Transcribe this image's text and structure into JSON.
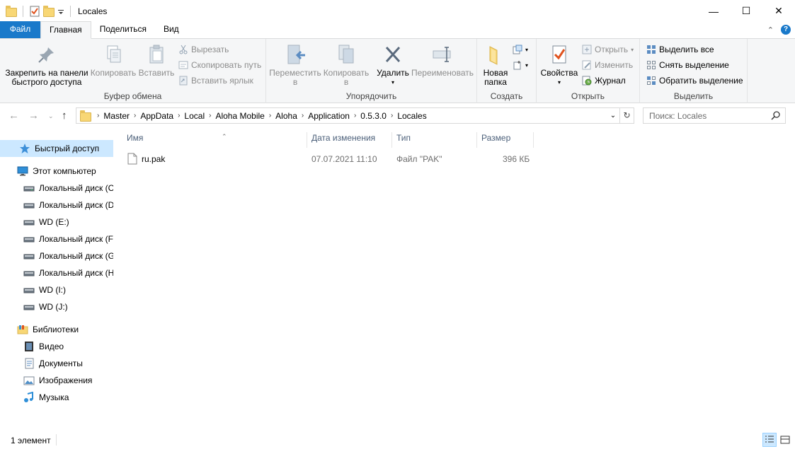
{
  "window": {
    "title": "Locales",
    "minimize": "—",
    "maximize": "☐",
    "close": "✕"
  },
  "tabs": [
    {
      "label": "Файл"
    },
    {
      "label": "Главная"
    },
    {
      "label": "Поделиться"
    },
    {
      "label": "Вид"
    }
  ],
  "ribbon": {
    "clipboard": {
      "label": "Буфер обмена",
      "pin": "Закрепить на панели быстрого доступа",
      "pin_line1": "Закрепить на панели",
      "pin_line2": "быстрого доступа",
      "copy": "Копировать",
      "paste": "Вставить",
      "cut": "Вырезать",
      "copy_path": "Скопировать путь",
      "paste_shortcut": "Вставить ярлык"
    },
    "organize": {
      "label": "Упорядочить",
      "move_line1": "Переместить",
      "move_line2": "в",
      "copy_line1": "Копировать",
      "copy_line2": "в",
      "delete": "Удалить",
      "rename": "Переименовать"
    },
    "new": {
      "label": "Создать",
      "new_folder_line1": "Новая",
      "new_folder_line2": "папка"
    },
    "open": {
      "label": "Открыть",
      "properties": "Свойства",
      "open": "Открыть",
      "edit": "Изменить",
      "history": "Журнал"
    },
    "select": {
      "label": "Выделить",
      "select_all": "Выделить все",
      "select_none": "Снять выделение",
      "invert": "Обратить выделение"
    }
  },
  "address": {
    "crumbs": [
      "Master",
      "AppData",
      "Local",
      "Aloha Mobile",
      "Aloha",
      "Application",
      "0.5.3.0",
      "Locales"
    ]
  },
  "search": {
    "placeholder": "Поиск: Locales"
  },
  "nav": {
    "quick_access": "Быстрый доступ",
    "this_pc": "Этот компьютер",
    "drives": [
      "Локальный диск (C",
      "Локальный диск (D",
      "WD (E:)",
      "Локальный диск (F",
      "Локальный диск (G",
      "Локальный диск (H",
      "WD (I:)",
      "WD (J:)"
    ],
    "libraries": "Библиотеки",
    "lib_items": [
      "Видео",
      "Документы",
      "Изображения",
      "Музыка"
    ]
  },
  "columns": {
    "name": "Имя",
    "date": "Дата изменения",
    "type": "Тип",
    "size": "Размер"
  },
  "files": [
    {
      "name": "ru.pak",
      "date": "07.07.2021 11:10",
      "type": "Файл \"PAK\"",
      "size": "396 КБ"
    }
  ],
  "status": {
    "count": "1 элемент"
  },
  "colors": {
    "file_tab": "#1979ca",
    "selection": "#cce8ff",
    "folder": "#f8d775"
  }
}
